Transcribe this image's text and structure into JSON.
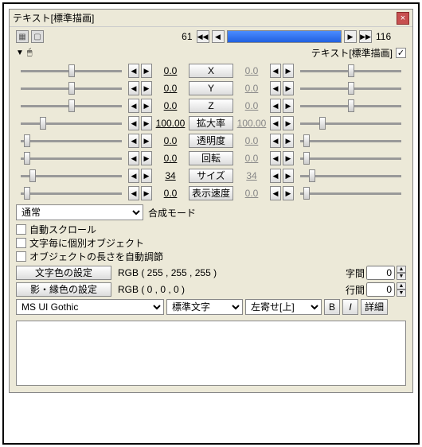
{
  "title": "テキスト[標準描画]",
  "frame_start": "61",
  "frame_end": "116",
  "header_label": "テキスト[標準描画]",
  "header_checked": true,
  "params": [
    {
      "label": "X",
      "left": "0.0",
      "right": "0.0",
      "lpos": 50,
      "rpos": 50
    },
    {
      "label": "Y",
      "left": "0.0",
      "right": "0.0",
      "lpos": 50,
      "rpos": 50
    },
    {
      "label": "Z",
      "left": "0.0",
      "right": "0.0",
      "lpos": 50,
      "rpos": 50
    },
    {
      "label": "拡大率",
      "left": "100.00",
      "right": "100.00",
      "lpos": 22,
      "rpos": 22
    },
    {
      "label": "透明度",
      "left": "0.0",
      "right": "0.0",
      "lpos": 6,
      "rpos": 6
    },
    {
      "label": "回転",
      "left": "0.0",
      "right": "0.0",
      "lpos": 6,
      "rpos": 6
    },
    {
      "label": "サイズ",
      "left": "34",
      "right": "34",
      "lpos": 12,
      "rpos": 12
    },
    {
      "label": "表示速度",
      "left": "0.0",
      "right": "0.0",
      "lpos": 6,
      "rpos": 6
    }
  ],
  "mode_label": "合成モード",
  "mode_value": "通常",
  "checks": [
    {
      "label": "自動スクロール",
      "checked": false
    },
    {
      "label": "文字毎に個別オブジェクト",
      "checked": false
    },
    {
      "label": "オブジェクトの長さを自動調節",
      "checked": false
    }
  ],
  "text_color_btn": "文字色の設定",
  "text_color_val": "RGB ( 255 , 255 , 255 )",
  "shadow_color_btn": "影・縁色の設定",
  "shadow_color_val": "RGB ( 0 , 0 , 0 )",
  "spacing_char_label": "字間",
  "spacing_char_val": "0",
  "spacing_line_label": "行間",
  "spacing_line_val": "0",
  "font": "MS UI Gothic",
  "style": "標準文字",
  "align": "左寄せ[上]",
  "btn_b": "B",
  "btn_i": "I",
  "btn_detail": "詳細",
  "textarea": ""
}
